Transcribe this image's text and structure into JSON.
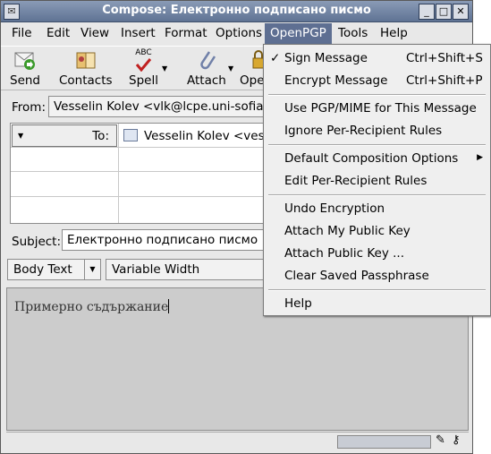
{
  "window": {
    "title": "Compose: Електронно подписано писмо",
    "icon": "mail-compose-icon",
    "buttons": [
      "_",
      "□",
      "✕"
    ]
  },
  "menubar": {
    "items": [
      "File",
      "Edit",
      "View",
      "Insert",
      "Format",
      "Options",
      "OpenPGP",
      "Tools",
      "Help"
    ],
    "active": "OpenPGP"
  },
  "toolbar": {
    "send": "Send",
    "contacts": "Contacts",
    "spell": "Spell",
    "attach": "Attach",
    "open": "Ope",
    "spell_abc": "ABC"
  },
  "from": {
    "label": "From:",
    "value": "Vesselin Kolev <vlk@lcpe.uni-sofia.bg>"
  },
  "recipients": {
    "type": "To:",
    "value": "Vesselin Kolev <vesso"
  },
  "subject": {
    "label": "Subject:",
    "value": "Електронно подписано писмо"
  },
  "format": {
    "text_style": "Body Text",
    "font": "Variable Width"
  },
  "body": {
    "text": "Примерно съдържание"
  },
  "openpgp_menu": {
    "sign": {
      "label": "Sign Message",
      "shortcut": "Ctrl+Shift+S",
      "checked": true
    },
    "encrypt": {
      "label": "Encrypt Message",
      "shortcut": "Ctrl+Shift+P"
    },
    "pgpmime": {
      "label": "Use PGP/MIME for This Message"
    },
    "ignore": {
      "label": "Ignore Per-Recipient Rules"
    },
    "defaults": {
      "label": "Default Composition Options"
    },
    "edit_rules": {
      "label": "Edit Per-Recipient Rules"
    },
    "undo": {
      "label": "Undo Encryption"
    },
    "attach_my": {
      "label": "Attach My Public Key"
    },
    "attach_key": {
      "label": "Attach Public Key ..."
    },
    "clear": {
      "label": "Clear Saved Passphrase"
    },
    "help": {
      "label": "Help"
    }
  },
  "colors": {
    "menu_highlight": "#5e6f92",
    "titlebar": "#6f82a3",
    "body_bg": "#cccccc"
  }
}
